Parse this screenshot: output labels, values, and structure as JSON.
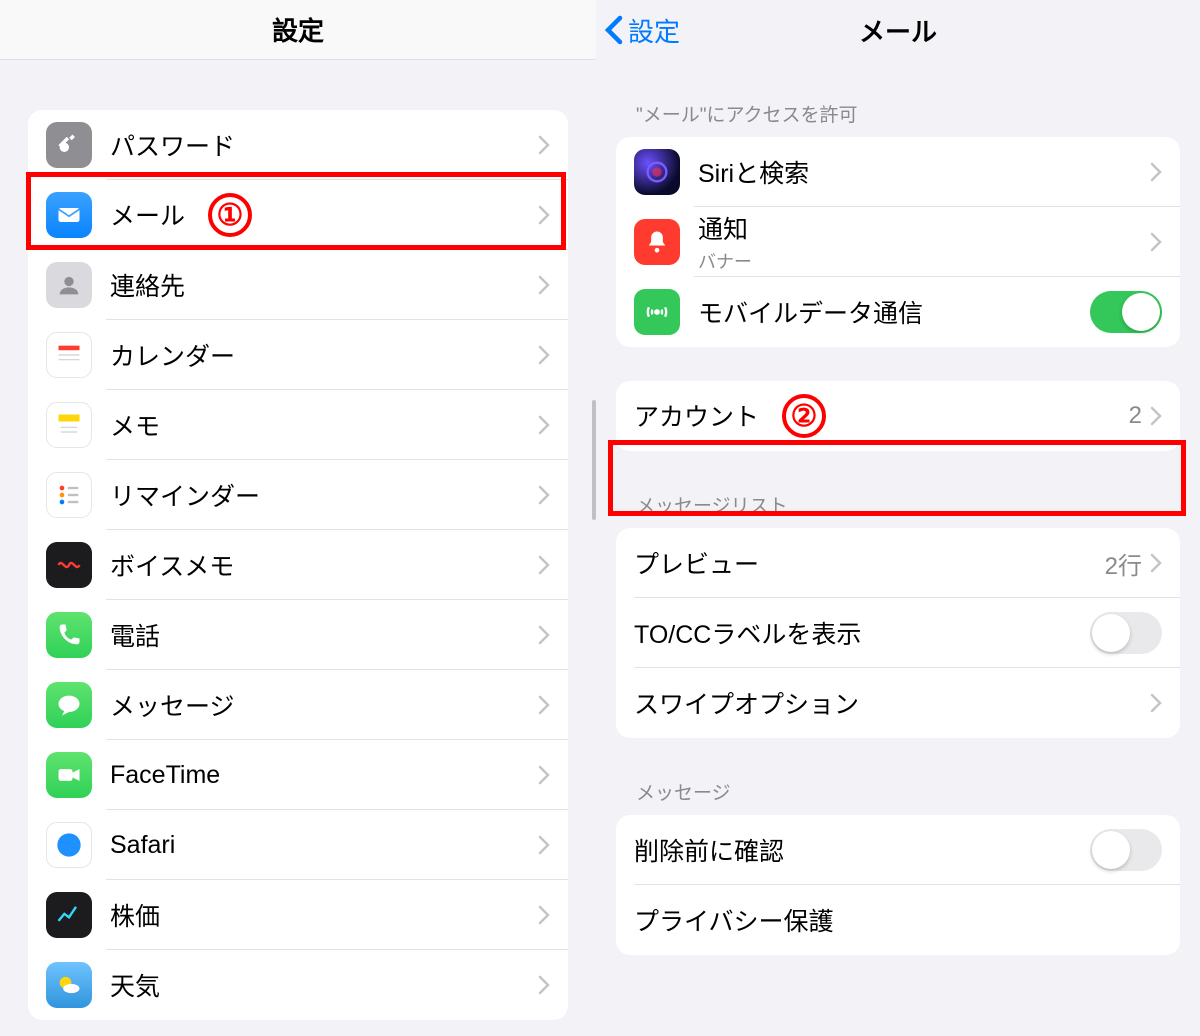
{
  "left": {
    "title": "設定",
    "items": [
      {
        "key": "passwords",
        "label": "パスワード"
      },
      {
        "key": "mail",
        "label": "メール",
        "badge": "①"
      },
      {
        "key": "contacts",
        "label": "連絡先"
      },
      {
        "key": "calendar",
        "label": "カレンダー"
      },
      {
        "key": "notes",
        "label": "メモ"
      },
      {
        "key": "reminders",
        "label": "リマインダー"
      },
      {
        "key": "voicememo",
        "label": "ボイスメモ"
      },
      {
        "key": "phone",
        "label": "電話"
      },
      {
        "key": "messages",
        "label": "メッセージ"
      },
      {
        "key": "facetime",
        "label": "FaceTime"
      },
      {
        "key": "safari",
        "label": "Safari"
      },
      {
        "key": "stocks",
        "label": "株価"
      },
      {
        "key": "weather",
        "label": "天気"
      }
    ]
  },
  "right": {
    "back": "設定",
    "title": "メール",
    "allow_header": "\"メール\"にアクセスを許可",
    "siri": "Siriと検索",
    "notif": "通知",
    "notif_sub": "バナー",
    "cellular": "モバイルデータ通信",
    "cellular_on": true,
    "account_label": "アカウント",
    "account_badge": "②",
    "account_value": "2",
    "msglist_header": "メッセージリスト",
    "preview": "プレビュー",
    "preview_value": "2行",
    "tocc": "TO/CCラベルを表示",
    "tocc_on": false,
    "swipe": "スワイプオプション",
    "msg_header": "メッセージ",
    "confirm_delete": "削除前に確認",
    "confirm_delete_on": false,
    "privacy": "プライバシー保護"
  }
}
